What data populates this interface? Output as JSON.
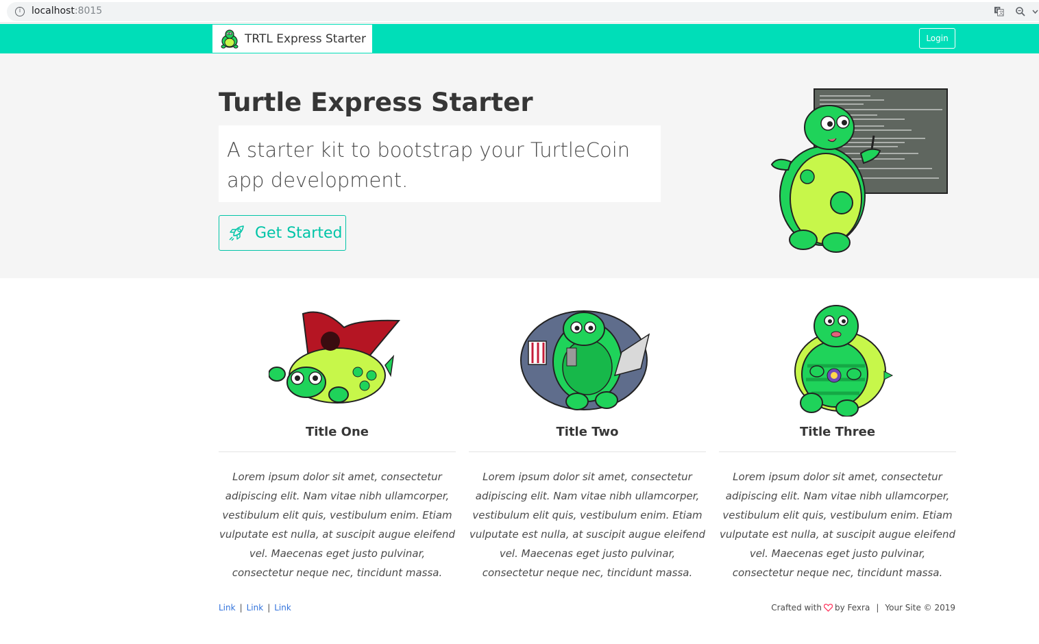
{
  "browser": {
    "url_host": "localhost",
    "url_port": ":8015"
  },
  "navbar": {
    "brand": "TRTL Express Starter",
    "login_label": "Login"
  },
  "hero": {
    "title": "Turtle Express Starter",
    "subtitle": "A starter kit to bootstrap your TurtleCoin app development.",
    "cta_label": "Get Started"
  },
  "features": [
    {
      "title": "Title One",
      "text": "Lorem ipsum dolor sit amet, consectetur adipiscing elit. Nam vitae nibh ullamcorper, vestibulum elit quis, vestibulum enim. Etiam vulputate est nulla, at suscipit augue eleifend vel. Maecenas eget justo pulvinar, consectetur neque nec, tincidunt massa."
    },
    {
      "title": "Title Two",
      "text": "Lorem ipsum dolor sit amet, consectetur adipiscing elit. Nam vitae nibh ullamcorper, vestibulum elit quis, vestibulum enim. Etiam vulputate est nulla, at suscipit augue eleifend vel. Maecenas eget justo pulvinar, consectetur neque nec, tincidunt massa."
    },
    {
      "title": "Title Three",
      "text": "Lorem ipsum dolor sit amet, consectetur adipiscing elit. Nam vitae nibh ullamcorper, vestibulum elit quis, vestibulum enim. Etiam vulputate est nulla, at suscipit augue eleifend vel. Maecenas eget justo pulvinar, consectetur neque nec, tincidunt massa."
    }
  ],
  "footer": {
    "links": [
      "Link",
      "Link",
      "Link"
    ],
    "crafted_prefix": "Crafted with",
    "crafted_suffix": "by Fexra",
    "copyright": "Your Site © 2019"
  },
  "colors": {
    "primary": "#00deb8",
    "cta": "#00c4a7",
    "link": "#3273dc",
    "heart": "#ff3860"
  },
  "icons": [
    "info-icon",
    "translate-icon",
    "zoom-icon",
    "more-icon",
    "turtle-logo-icon",
    "rocket-icon",
    "heart-icon"
  ]
}
